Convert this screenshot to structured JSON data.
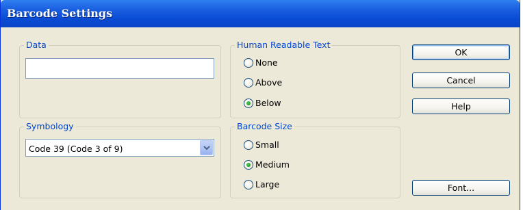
{
  "window": {
    "title": "Barcode Settings"
  },
  "data_group": {
    "label": "Data",
    "input_value": ""
  },
  "symbology_group": {
    "label": "Symbology",
    "selected": "Code 39 (Code 3 of 9)"
  },
  "human_readable_group": {
    "label": "Human Readable Text",
    "options": [
      {
        "label": "None",
        "checked": false
      },
      {
        "label": "Above",
        "checked": false
      },
      {
        "label": "Below",
        "checked": true
      }
    ]
  },
  "barcode_size_group": {
    "label": "Barcode Size",
    "options": [
      {
        "label": "Small",
        "checked": false
      },
      {
        "label": "Medium",
        "checked": true
      },
      {
        "label": "Large",
        "checked": false
      }
    ]
  },
  "buttons": {
    "ok": "OK",
    "cancel": "Cancel",
    "help": "Help",
    "font": "Font..."
  },
  "colors": {
    "titlebar": "#0a4bd4",
    "group_label": "#0046d5",
    "dialog_bg": "#ece9d8",
    "radio_selected": "#21a121"
  },
  "icons": {
    "dropdown": "chevron-down-icon"
  }
}
